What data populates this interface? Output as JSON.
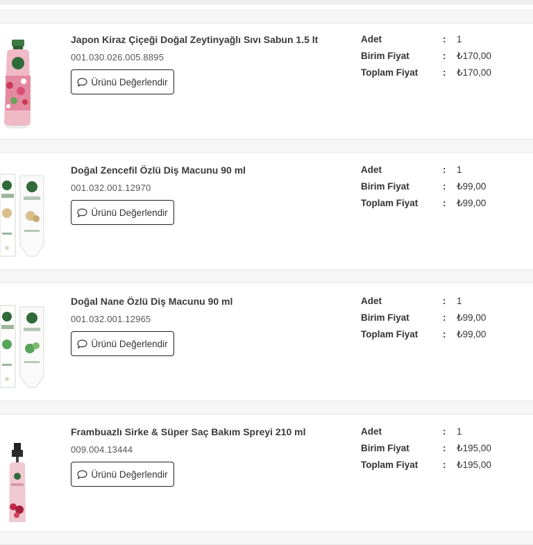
{
  "review_label": "Ürünü Değerlendir",
  "labels": {
    "qty": "Adet",
    "unit_price": "Birim Fiyat",
    "total_price": "Toplam Fiyat",
    "colon": ":"
  },
  "items": [
    {
      "title": "Japon Kiraz Çiçeği Doğal Zeytinyağlı Sıvı Sabun 1.5 lt",
      "code": "001.030.026.005.8895",
      "qty": "1",
      "unit_price": "₺170,00",
      "total_price": "₺170,00",
      "image": "pink-liquid-soap-bottle"
    },
    {
      "title": "Doğal Zencefil Özlü Diş Macunu 90 ml",
      "code": "001.032.001.12970",
      "qty": "1",
      "unit_price": "₺99,00",
      "total_price": "₺99,00",
      "image": "ginger-toothpaste-box-and-tube"
    },
    {
      "title": "Doğal Nane Özlü Diş Macunu 90 ml",
      "code": "001.032.001.12965",
      "qty": "1",
      "unit_price": "₺99,00",
      "total_price": "₺99,00",
      "image": "mint-toothpaste-box-and-tube"
    },
    {
      "title": "Frambuazlı Sirke & Süper Saç Bakım Spreyi 210 ml",
      "code": "009.004.13444",
      "qty": "1",
      "unit_price": "₺195,00",
      "total_price": "₺195,00",
      "image": "hair-care-spray-bottle"
    }
  ],
  "colors": {
    "border": "#222222",
    "separator": "#f6f6f6",
    "text": "#333333"
  }
}
